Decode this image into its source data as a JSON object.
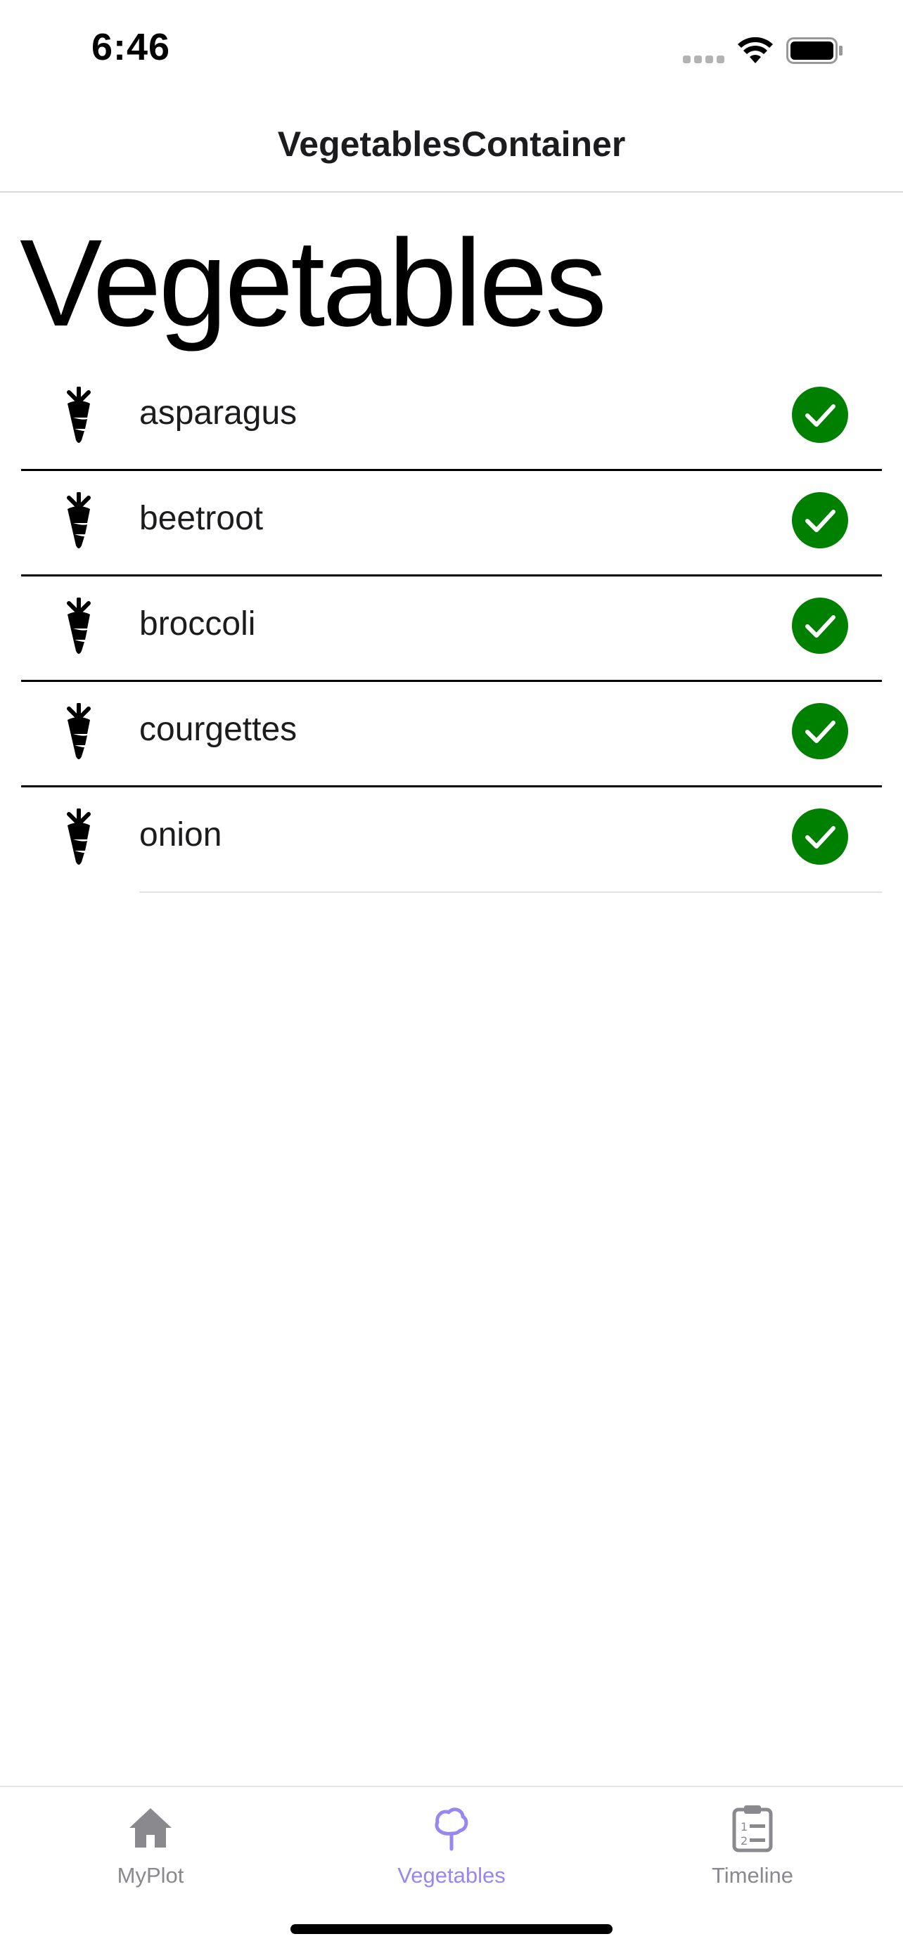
{
  "status_bar": {
    "time": "6:46",
    "icons": [
      "cellular-signal-icon",
      "wifi-icon",
      "battery-icon"
    ]
  },
  "nav": {
    "title": "VegetablesContainer"
  },
  "page": {
    "large_title": "Vegetables"
  },
  "vegetables": [
    {
      "name": "asparagus",
      "icon": "carrot-icon",
      "status_icon": "checkmark-circle-icon"
    },
    {
      "name": "beetroot",
      "icon": "carrot-icon",
      "status_icon": "checkmark-circle-icon"
    },
    {
      "name": "broccoli",
      "icon": "carrot-icon",
      "status_icon": "checkmark-circle-icon"
    },
    {
      "name": "courgettes",
      "icon": "carrot-icon",
      "status_icon": "checkmark-circle-icon"
    },
    {
      "name": "onion",
      "icon": "carrot-icon",
      "status_icon": "checkmark-circle-icon"
    }
  ],
  "tab_bar": {
    "tabs": [
      {
        "label": "MyPlot",
        "icon": "house-icon",
        "selected": false
      },
      {
        "label": "Vegetables",
        "icon": "tree-icon",
        "selected": true
      },
      {
        "label": "Timeline",
        "icon": "clipboard-list-icon",
        "selected": false
      }
    ]
  },
  "colors": {
    "check_green": "#008000",
    "tab_active": "#9a86f0",
    "tab_inactive": "#8a8a8e"
  }
}
